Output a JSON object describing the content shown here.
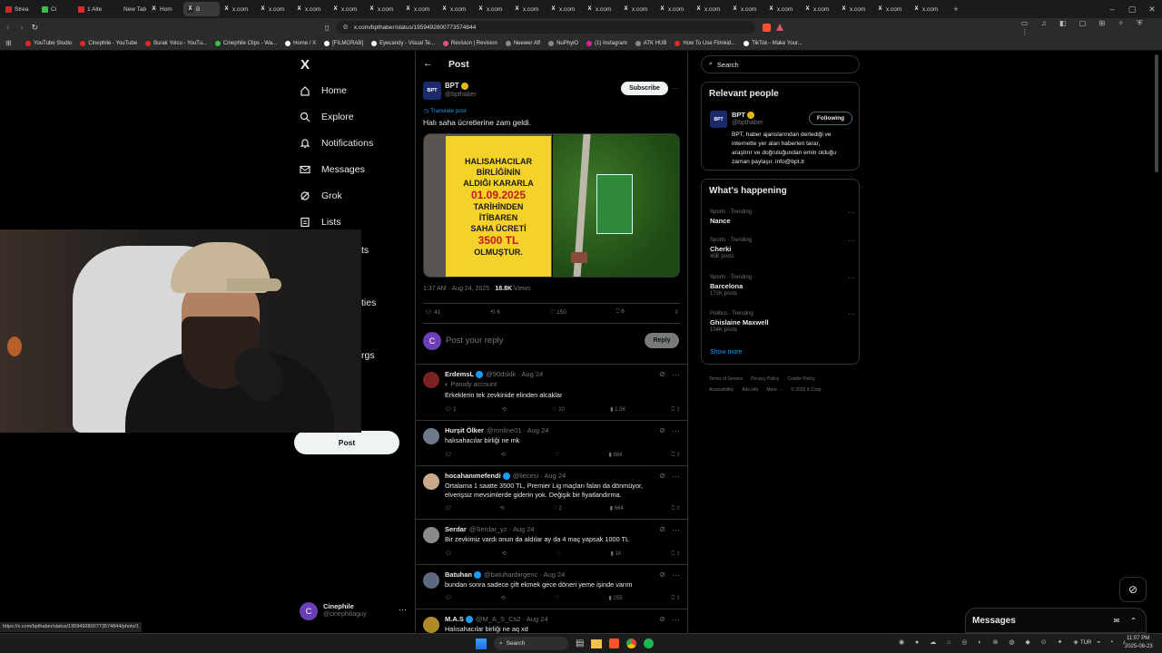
{
  "browser": {
    "tabs": [
      "Strea",
      "Ci",
      "1 Alte",
      "New Tab",
      "Hom",
      "B",
      "x.com",
      "x.com",
      "x.com",
      "x.com",
      "x.com",
      "x.com",
      "x.com",
      "x.com",
      "x.com",
      "x.com",
      "x.com",
      "x.com",
      "x.com",
      "x.com",
      "x.com",
      "x.com",
      "x.com",
      "x.com",
      "x.com",
      "x.com"
    ],
    "url": "x.com/bpthaber/status/1959492800773574844",
    "bookmarks": [
      "YouTube Studio",
      "Cinephile - YouTube",
      "Burak Yolcu - YouTu...",
      "Cinephile Clips - Wa...",
      "Home / X",
      "[FILMGRAB]",
      "Eyecandy - Visual Te...",
      "Revision | Revision",
      "Neewer Aff",
      "NuPhylO",
      "(1) Instagram",
      "ATK HUB",
      "How To Use Filmkid...",
      "TikTok - Make Your..."
    ],
    "status_url": "https://x.com/bpthaber/status/1959492800773574844/photo/1"
  },
  "nav": {
    "logo": "X",
    "items": [
      {
        "label": "Home",
        "icon": "home-icon"
      },
      {
        "label": "Explore",
        "icon": "search-icon"
      },
      {
        "label": "Notifications",
        "icon": "bell-icon"
      },
      {
        "label": "Messages",
        "icon": "envelope-icon"
      },
      {
        "label": "Grok",
        "icon": "grok-icon"
      },
      {
        "label": "Lists",
        "icon": "list-icon"
      }
    ],
    "partial_labels": [
      "ts",
      "ties",
      "rgs"
    ],
    "post_button": "Post",
    "account": {
      "name": "Cinephile",
      "handle": "@cinephiliaguy",
      "initial": "C"
    }
  },
  "header": {
    "title": "Post"
  },
  "post": {
    "author": "BPT",
    "handle": "@bpthaber",
    "avatar_text": "BPT",
    "subscribe": "Subscribe",
    "translate": "Translate post",
    "text": "Halı saha ücretlerine zam geldi.",
    "sign_lines": [
      "HALISAHACILAR",
      "BİRLİĞİNİN",
      "ALDIĞI KARARLA",
      "01.09.2025",
      "TARİHİNDEN",
      "İTİBAREN",
      "SAHA ÜCRETİ",
      "3500 TL",
      "OLMUŞTUR."
    ],
    "time": "1:37 AM · Aug 24, 2025 · ",
    "views": "18.8K",
    "views_label": " Views",
    "stats": {
      "replies": "41",
      "reposts": "6",
      "likes": "150",
      "bookmarks": "6"
    },
    "reply_placeholder": "Post your reply",
    "reply_button": "Reply",
    "me_initial": "C"
  },
  "replies": [
    {
      "name": "ErdemsL",
      "handle": "@90dsklk · Aug 24",
      "badge": "Parody account",
      "text": [
        "Erkeklerin tek zevkinide elinden alcaklar"
      ],
      "stats": [
        "1",
        "",
        "10",
        "1.5K"
      ],
      "color": "#7a2222"
    },
    {
      "name": "Hurşit Ölker",
      "handle": "@ronline01 · Aug 24",
      "text": [
        "halısahacılar birliği ne mk"
      ],
      "stats": [
        "",
        "",
        "",
        "884"
      ],
      "color": "#6c7a8a"
    },
    {
      "name": "hocahanımefendi",
      "handle": "@liecesi · Aug 24",
      "text": [
        "Ortalama 1 saatte 3500 TL, Premier Lig maçları falan da dönmüyor,",
        "elverişsiz mevsimlerde giderin yok. Değişik bir fiyatlandırma."
      ],
      "stats": [
        "",
        "",
        "2",
        "664"
      ],
      "color": "#c9a98a"
    },
    {
      "name": "Serdar",
      "handle": "@Serdar_yz · Aug 24",
      "text": [
        "Bir zevkimiz vardı onun da aldılar ay da 4 maç yapsak 1000 TL"
      ],
      "stats": [
        "",
        "",
        "",
        "1K"
      ],
      "color": "#8a8a8a"
    },
    {
      "name": "Batuhan",
      "handle": "@batuhanbirgenc · Aug 24",
      "text": [
        "bundan sonra sadece çift ekmek gece döneri yeme işinde varım"
      ],
      "stats": [
        "",
        "",
        "",
        "255"
      ],
      "color": "#5a6a80"
    },
    {
      "name": "M.A.S",
      "handle": "@M_A_S_Cs2 · Aug 24",
      "text": [
        "Halısahacılar birliği ne aq xd"
      ],
      "stats": [
        "",
        "",
        "",
        ""
      ],
      "color": "#b08a2a"
    }
  ],
  "search": {
    "placeholder": "Search"
  },
  "relevant": {
    "title": "Relevant people",
    "name": "BPT",
    "handle": "@bpthaber",
    "button": "Following",
    "bio": [
      "BPT, haber ajanslarından derlediği ve",
      "internette yer alan haberleri tarar,",
      "araştırır ve doğruluğundan emin olduğu",
      "zaman paylaşır. info@bpt.tr"
    ]
  },
  "happening": {
    "title": "What's happening",
    "trends": [
      {
        "cat": "Sports · Trending",
        "name": "Nance",
        "posts": ""
      },
      {
        "cat": "Sports · Trending",
        "name": "Cherki",
        "posts": "45K posts"
      },
      {
        "cat": "Sports · Trending",
        "name": "Barcelona",
        "posts": "172K posts"
      },
      {
        "cat": "Politics · Trending",
        "name": "Ghislaine Maxwell",
        "posts": "104K posts"
      }
    ],
    "show_more": "Show more"
  },
  "footer": {
    "links": [
      "Terms of Service",
      "Privacy Policy",
      "Cookie Policy",
      "Accessibility",
      "Ads info",
      "More ···",
      "© 2025 X Corp."
    ]
  },
  "messages_dock": {
    "title": "Messages"
  },
  "taskbar": {
    "search": "Search",
    "lang": "TUR",
    "time": "11:07 PM",
    "date": "2025-08-23"
  },
  "colors": {
    "accent": "#1d9bf0",
    "bg": "#000000",
    "border": "#2f3336",
    "verified_gold": "#e2b719"
  }
}
